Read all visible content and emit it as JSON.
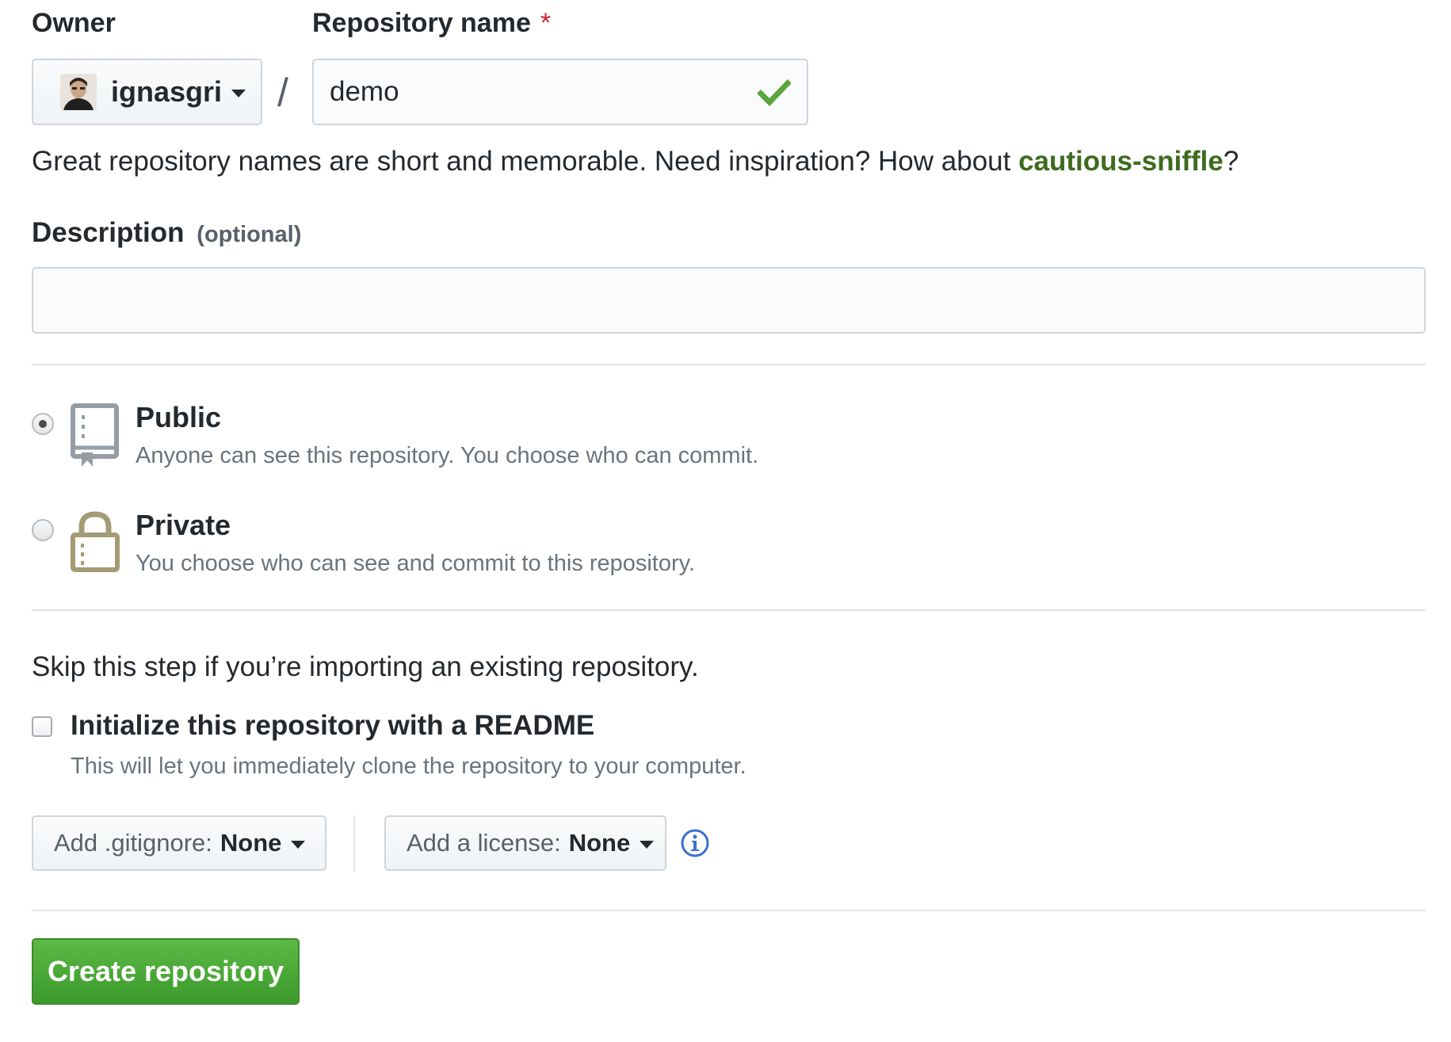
{
  "owner": {
    "label": "Owner",
    "value": "ignasgri"
  },
  "repository_name": {
    "label": "Repository name",
    "required_mark": "*",
    "value": "demo",
    "valid": true
  },
  "separator": "/",
  "hint": {
    "prefix": "Great repository names are short and memorable. Need inspiration? How about ",
    "suggestion": "cautious-sniffle",
    "suffix": "?"
  },
  "description": {
    "label": "Description",
    "optional": "(optional)",
    "value": ""
  },
  "visibility": {
    "selected": "public",
    "options": [
      {
        "title": "Public",
        "note": "Anyone can see this repository. You choose who can commit.",
        "icon": "repo-book-icon"
      },
      {
        "title": "Private",
        "note": "You choose who can see and commit to this repository.",
        "icon": "lock-icon"
      }
    ]
  },
  "init": {
    "skip_text": "Skip this step if you’re importing an existing repository.",
    "readme_label": "Initialize this repository with a README",
    "readme_note": "This will let you immediately clone the repository to your computer.",
    "readme_checked": false
  },
  "gitignore": {
    "label": "Add .gitignore:",
    "value": "None"
  },
  "license": {
    "label": "Add a license:",
    "value": "None"
  },
  "create_button": "Create repository",
  "colors": {
    "suggestion": "#3d6b1f",
    "create_button": "#4cab38",
    "check": "#5aa53c",
    "info": "#3b6fd1",
    "icon_olive": "#a39b73"
  }
}
